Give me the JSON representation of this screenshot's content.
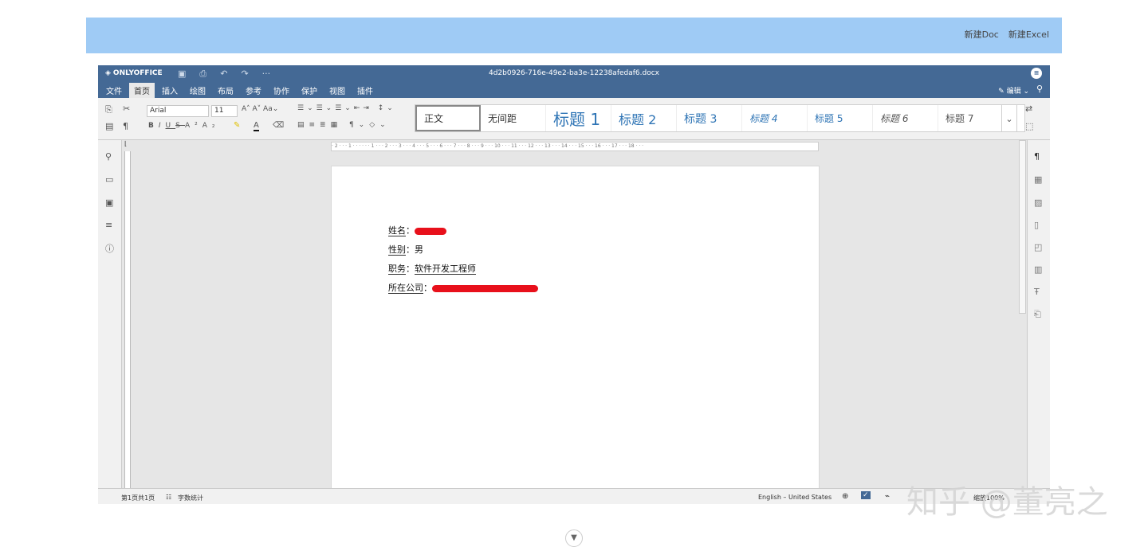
{
  "host": {
    "new_doc": "新建Doc",
    "new_excel": "新建Excel"
  },
  "app": {
    "logo": "ONLYOFFICE",
    "doc_title": "4d2b0926-716e-49e2-ba3e-12238afedaf6.docx",
    "tabs": [
      "文件",
      "首页",
      "插入",
      "绘图",
      "布局",
      "参考",
      "协作",
      "保护",
      "视图",
      "插件"
    ],
    "active_tab": "首页",
    "edit_mode": "编辑",
    "font_name": "Arial",
    "font_size": "11",
    "styles": [
      "正文",
      "无间距",
      "标题 1",
      "标题 2",
      "标题 3",
      "标题 4",
      "标题 5",
      "标题 6",
      "标题 7"
    ],
    "selected_style": "正文"
  },
  "document": {
    "lines": [
      {
        "label": "姓名",
        "sep": "：",
        "value": "",
        "redacted": true
      },
      {
        "label": "性别",
        "sep": "：",
        "value": "男",
        "redacted": false
      },
      {
        "label": "职务",
        "sep": "：",
        "value": "软件开发工程师",
        "redacted": false
      },
      {
        "label": "所在公司",
        "sep": "：",
        "value": "",
        "redacted": true
      }
    ]
  },
  "ruler": {
    "h_marks": "· 2 · · · 1 · · · · · · 1 · · · 2 · · · 3 · · · 4 · · · 5 · · · 6 · · · 7 · · · 8 · · · 9 · · · 10 · · · 11 · · · 12 · · · 13 · · · 14 · · · 15 · · · 16 · · · 17 · · · 18 · · ·"
  },
  "status": {
    "page_info": "第1页共1页",
    "word_count": "字数统计",
    "language": "English – United States",
    "zoom": "缩放100%"
  },
  "watermark": "知乎 @董亮之",
  "colors": {
    "titlebar": "#446995",
    "host_bar": "#9fcbf5",
    "heading": "#2e74b5",
    "redaction": "#e8101b"
  }
}
